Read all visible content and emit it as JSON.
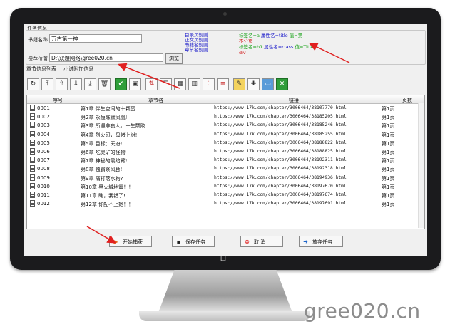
{
  "task": {
    "group_label": "任务信息",
    "book_name_label": "书籍名称",
    "book_name_value": "万古第一神",
    "save_location_label": "保存位置",
    "save_location_value": "D:\\双煜网络\\gree020.cn",
    "browse_label": "浏览"
  },
  "radio_options": [
    "目录页规则",
    "正文页规则",
    "书籍名规则",
    "章节名规则"
  ],
  "rules": {
    "line1": {
      "a": "标签名=a",
      "b": "属性名=title",
      "c": "值=第"
    },
    "line2": "不分页",
    "line3": {
      "a": "标签名=h1",
      "b": "属性名=class",
      "c": "值=Title"
    },
    "line4": "div"
  },
  "tabs": [
    "章节信息列表",
    "小说附加信息"
  ],
  "columns": [
    "序号",
    "章节名",
    "链接",
    "页数"
  ],
  "rows": [
    {
      "id": "0001",
      "title": "第1章 伴生空间的十颗蛋",
      "url": "https://www.17k.com/chapter/3006464/38107770.html",
      "pages": "第1页"
    },
    {
      "id": "0002",
      "title": "第2章 永恒炼狱凤凰!",
      "url": "https://www.17k.com/chapter/3006464/38185205.html",
      "pages": "第1页"
    },
    {
      "id": "0003",
      "title": "第3章 所遇非良人，一生颓败",
      "url": "https://www.17k.com/chapter/3006464/38185246.html",
      "pages": "第1页"
    },
    {
      "id": "0004",
      "title": "第4章 烈火印，母猪上树!",
      "url": "https://www.17k.com/chapter/3006464/38185255.html",
      "pages": "第1页"
    },
    {
      "id": "0005",
      "title": "第5章 目标：天府!",
      "url": "https://www.17k.com/chapter/3006464/38188822.html",
      "pages": "第1页"
    },
    {
      "id": "0006",
      "title": "第6章 吃灵矿的怪物",
      "url": "https://www.17k.com/chapter/3006464/38188825.html",
      "pages": "第1页"
    },
    {
      "id": "0007",
      "title": "第7章 神秘的黑暗臂!",
      "url": "https://www.17k.com/chapter/3006464/38192311.html",
      "pages": "第1页"
    },
    {
      "id": "0008",
      "title": "第8章 独霸祭风台!",
      "url": "https://www.17k.com/chapter/3006464/38192318.html",
      "pages": "第1页"
    },
    {
      "id": "0009",
      "title": "第9章 痛打落水狗?",
      "url": "https://www.17k.com/chapter/3006464/38194936.html",
      "pages": "第1页"
    },
    {
      "id": "0010",
      "title": "第10章 黑火城地震！！",
      "url": "https://www.17k.com/chapter/3006464/38197670.html",
      "pages": "第1页"
    },
    {
      "id": "0011",
      "title": "第11章 瞎，我错了!",
      "url": "https://www.17k.com/chapter/3006464/38197674.html",
      "pages": "第1页"
    },
    {
      "id": "0012",
      "title": "第12章 你配不上她！！",
      "url": "https://www.17k.com/chapter/3006464/38197691.html",
      "pages": "第1页"
    }
  ],
  "buttons": {
    "start": "开始捕获",
    "save": "保存任务",
    "cancel": "取 消",
    "abandon": "放弃任务"
  },
  "watermark": "gree020.cn",
  "colors": {
    "bezel": "#1b1b1d",
    "rule_green": "#12a012",
    "rule_blue": "#1414c8",
    "rule_red": "#d01818",
    "arrow": "#e02020"
  }
}
